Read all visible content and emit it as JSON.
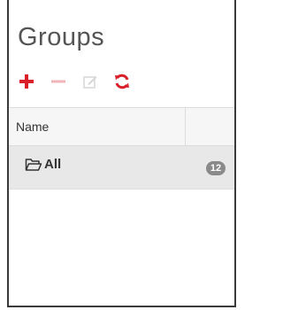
{
  "panel": {
    "title": "Groups"
  },
  "toolbar": {
    "add_icon": "plus-icon",
    "remove_icon": "minus-icon",
    "edit_icon": "edit-icon",
    "refresh_icon": "refresh-icon",
    "accent_color": "#d9202a",
    "disabled_color": "#f1b4b8"
  },
  "grid": {
    "columns": [
      "Name",
      ""
    ],
    "rows": [
      {
        "icon": "folder-open-icon",
        "name": "All",
        "count": "12"
      }
    ]
  }
}
